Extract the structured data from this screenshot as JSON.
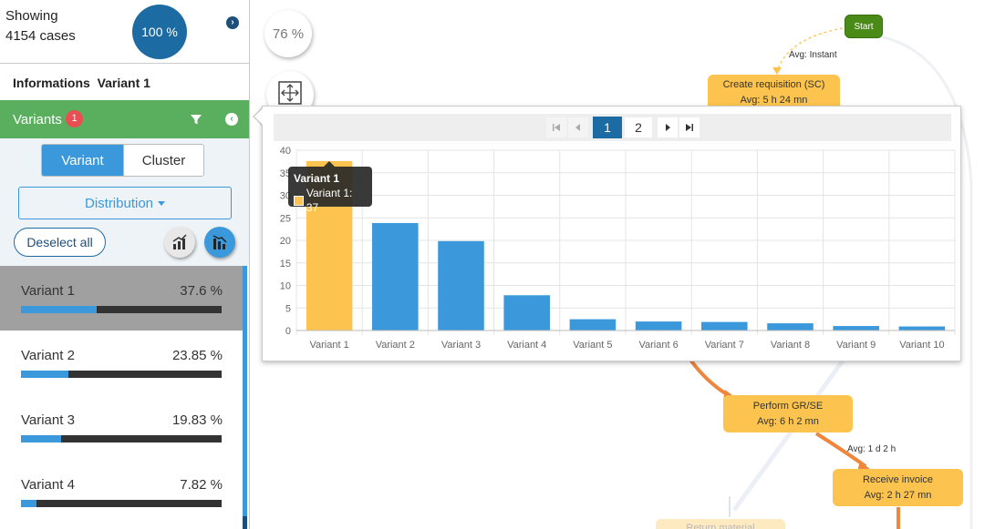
{
  "summary": {
    "showing_label": "Showing",
    "cases_label": "4154 cases",
    "percent": "100 %"
  },
  "info": {
    "label": "Informations",
    "value": "Variant 1"
  },
  "variants_panel": {
    "title": "Variants",
    "badge": "1",
    "toggle_variant": "Variant",
    "toggle_cluster": "Cluster",
    "distribution_label": "Distribution",
    "deselect_label": "Deselect all",
    "items": [
      {
        "name": "Variant 1",
        "percent": "37.6 %",
        "fraction": 0.376,
        "selected": true
      },
      {
        "name": "Variant 2",
        "percent": "23.85 %",
        "fraction": 0.2385,
        "selected": false
      },
      {
        "name": "Variant 3",
        "percent": "19.83 %",
        "fraction": 0.1983,
        "selected": false
      },
      {
        "name": "Variant 4",
        "percent": "7.82 %",
        "fraction": 0.0782,
        "selected": false
      }
    ]
  },
  "map": {
    "zoom": "76 %",
    "start_label": "Start",
    "nodes": {
      "create": {
        "title": "Create requisition (SC)",
        "avg": "Avg: 5 h 24 mn"
      },
      "gr": {
        "title": "Perform GR/SE",
        "avg": "Avg: 6 h 2 mn"
      },
      "invoice": {
        "title": "Receive invoice",
        "avg": "Avg: 2 h 27 mn"
      },
      "return": {
        "title": "Return material"
      }
    },
    "edge_labels": [
      "Avg: Instant",
      "Avg: 1 d 2 h"
    ],
    "colors": {
      "node": "#fcc44e",
      "start": "#4a8a17",
      "edge": "#f0853c"
    }
  },
  "pager": {
    "pages": [
      "1",
      "2"
    ],
    "active": "1",
    "first_icon": "first-page-icon",
    "prev_icon": "prev-page-icon",
    "next_icon": "next-page-icon",
    "last_icon": "last-page-icon"
  },
  "tooltip": {
    "title": "Variant 1",
    "body": "Variant 1: 37"
  },
  "chart_data": {
    "type": "bar",
    "categories": [
      "Variant 1",
      "Variant 2",
      "Variant 3",
      "Variant 4",
      "Variant 5",
      "Variant 6",
      "Variant 7",
      "Variant 8",
      "Variant 9",
      "Variant 10"
    ],
    "values": [
      37.6,
      23.85,
      19.83,
      7.82,
      2.5,
      2.0,
      1.9,
      1.6,
      1.0,
      0.9
    ],
    "highlighted_index": 0,
    "highlight_color": "#fcc44e",
    "bar_color": "#3a98db",
    "title": "",
    "xlabel": "",
    "ylabel": "",
    "ylim": [
      0,
      40
    ],
    "yticks": [
      0,
      5,
      10,
      15,
      20,
      25,
      30,
      35,
      40
    ],
    "grid": true
  }
}
